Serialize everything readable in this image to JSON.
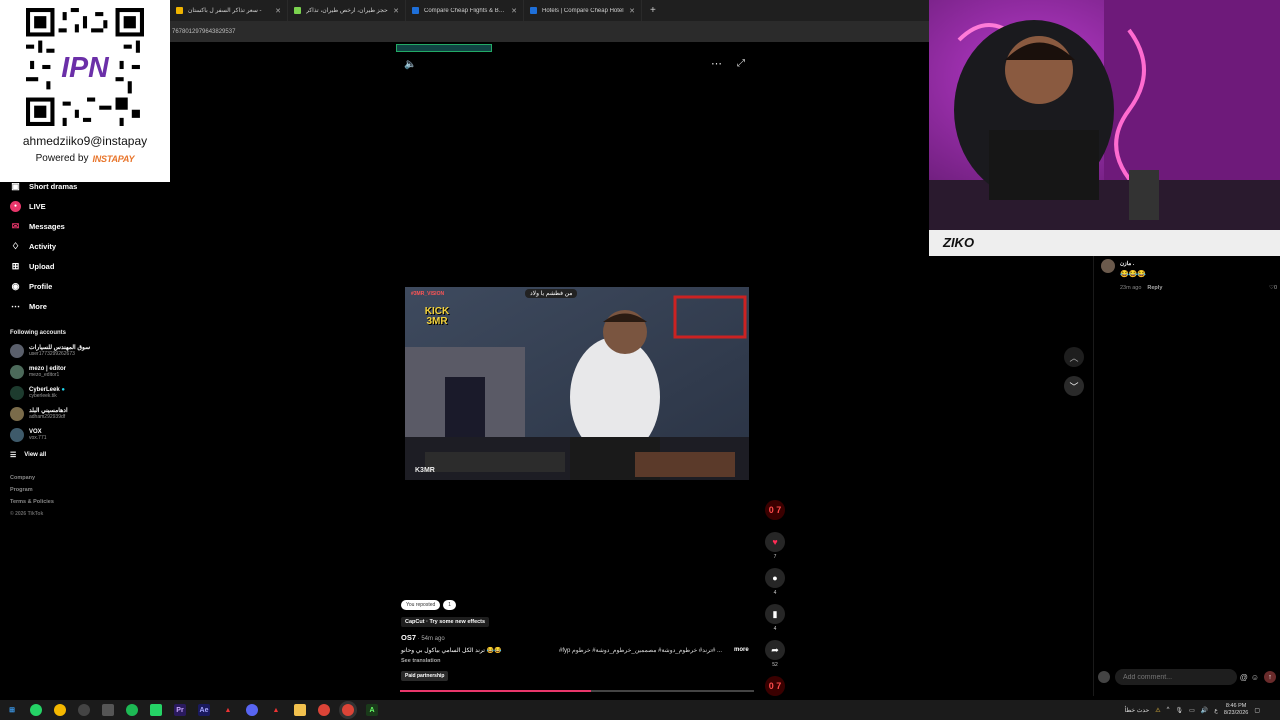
{
  "browser": {
    "tabs": [
      {
        "title": "سعر تذاكر السفر ل باكستان -",
        "color": "#f0b400"
      },
      {
        "title": "حجز طيران، ارخص طيران، تذاكر",
        "color": "#7bd34f"
      },
      {
        "title": "Compare Cheap Flights & Booki",
        "color": "#1e6fd9"
      },
      {
        "title": "Hotels | Compare Cheap Hotel",
        "color": "#1e6fd9"
      }
    ],
    "new_tab": "+",
    "url": "7678012979643829537"
  },
  "qr": {
    "handle": "ahmedziiko9@instapay",
    "powered_by": "Powered by",
    "brand": "INSTAPAY"
  },
  "sidebar": {
    "items": [
      {
        "label": "Short dramas",
        "icon": "drama-icon"
      },
      {
        "label": "LIVE",
        "icon": "live-icon"
      },
      {
        "label": "Messages",
        "icon": "messages-icon"
      },
      {
        "label": "Activity",
        "icon": "activity-icon"
      },
      {
        "label": "Upload",
        "icon": "upload-icon"
      },
      {
        "label": "Profile",
        "icon": "profile-icon"
      },
      {
        "label": "More",
        "icon": "more-icon"
      }
    ],
    "following_title": "Following accounts",
    "accounts": [
      {
        "name": "سوق المهندس للسيارات",
        "handle": "user1773299262673"
      },
      {
        "name": "mezo | editor",
        "handle": "mezo_editor1"
      },
      {
        "name": "CyberLeek",
        "handle": "cyberleek.tik"
      },
      {
        "name": "ادهامسيني البلد",
        "handle": "adham292939df"
      },
      {
        "name": "VOX",
        "handle": "vox.771"
      }
    ],
    "view_all": "View all",
    "footer": [
      "Company",
      "Program",
      "Terms & Policies"
    ],
    "copyright": "© 2026 TikTok"
  },
  "video": {
    "top_caption": "من فطشم يا ولاد",
    "tag": "#3MR_VISION",
    "kick_text": "KICK 3MR",
    "watermark": "K3MR"
  },
  "actions": {
    "avatar_text": "0 7",
    "like_count": "7",
    "comment_count": "4",
    "save_count": "4",
    "share_count": "52",
    "bottom_avatar": "0 7"
  },
  "post": {
    "reposted": "You reposted",
    "repost_count": "1",
    "effect": "CapCut · Try some new effects",
    "author": "OS7",
    "time": " · 54m ago",
    "desc_ar": "ترند الكل السامي بياكول بي وحانو 😂😂",
    "desc_tags": "#fyp ترند# خرطوم_دوشة# مصممين_خرطوم_دوشة# خرطوم# ...",
    "more": "more",
    "see_translation": "See translation",
    "paid": "Paid partnership",
    "progress": 0.54
  },
  "comments": {
    "items": [
      {
        "name": "مازن .",
        "text": "😂😂😂",
        "time": "23m ago",
        "reply": "Reply",
        "likes": "0"
      }
    ],
    "placeholder": "Add comment...",
    "mention_icon": "@",
    "emoji_icon": "☺"
  },
  "webcam": {
    "label": "ZIKO"
  },
  "taskbar": {
    "status": "حدث خطأ",
    "time": "8:46 PM",
    "date": "8/23/2026",
    "lang": "ع"
  }
}
